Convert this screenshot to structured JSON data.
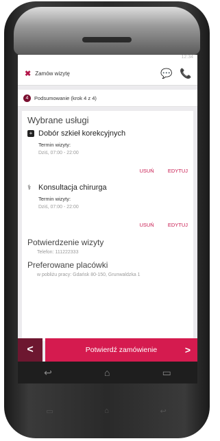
{
  "appbar": {
    "close_icon": "✖",
    "title": "Zamów wizytę",
    "chat_icon": "💬",
    "phone_icon": "📞",
    "status_time": "12:34"
  },
  "step": {
    "number": "4",
    "label": "Podsumowanie (krok 4 z 4)"
  },
  "services": {
    "heading": "Wybrane usługi",
    "items": [
      {
        "icon": "plus-box-icon",
        "name": "Dobór szkieł korekcyjnych",
        "term_label": "Termin wizyty:",
        "term_value": "Dziś, 07:00 - 22:00",
        "remove": "USUŃ",
        "edit": "EDYTUJ"
      },
      {
        "icon": "stethoscope-icon",
        "name": "Konsultacja chirurga",
        "term_label": "Termin wizyty:",
        "term_value": "Dziś, 07:00 - 22:00",
        "remove": "USUŃ",
        "edit": "EDYTUJ"
      }
    ]
  },
  "confirmation": {
    "heading": "Potwierdzenie wizyty",
    "phone": "Telefon: 111222333"
  },
  "locations": {
    "heading": "Preferowane placówki",
    "value": "w pobliżu pracy: Gdańsk 80-150, Grunwaldzka 1"
  },
  "bottom": {
    "back": "<",
    "confirm": "Potwierdź zamówienie",
    "arrow": ">"
  },
  "colors": {
    "accent": "#d51b4f",
    "dark_accent": "#6d1730"
  }
}
